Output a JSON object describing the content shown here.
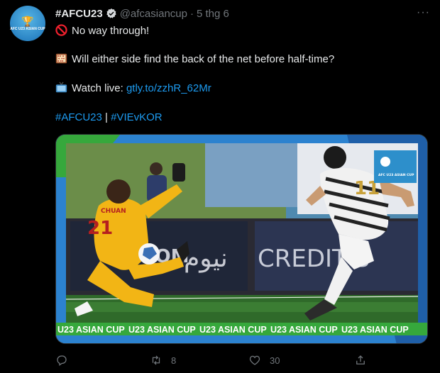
{
  "tweet": {
    "display_name": "#AFCU23",
    "handle": "@afcasiancup",
    "separator": "·",
    "date": "5 thg 6",
    "more_label": "···",
    "avatar_text": "AFC U23 ASIAN CUP",
    "line1": "No way through!",
    "line2": "Will either side find the back of the net before half-time?",
    "line3_prefix": "Watch live: ",
    "line3_link": "gtly.to/zzhR_62Mr",
    "hashtag1": "#AFCU23",
    "hashtag_sep": " | ",
    "hashtag2": "#VIEvKOR"
  },
  "media": {
    "board_text_1": "CREDIT S",
    "board_text_2": "نيوم",
    "board_text_3": "NEOM",
    "keeper_name": "CHUAN",
    "keeper_number": "21",
    "striker_number": "11",
    "corner_logo_text": "AFC U23 ASIAN CUP",
    "ticker_text": "U23 ASIAN CUP",
    "ticker_repeats": 5
  },
  "actions": {
    "retweets": "8",
    "likes": "30"
  },
  "colors": {
    "link": "#1d9bf0",
    "muted": "#71767b",
    "ticker_green": "#36a83c",
    "keeper_yellow": "#f2b515"
  }
}
